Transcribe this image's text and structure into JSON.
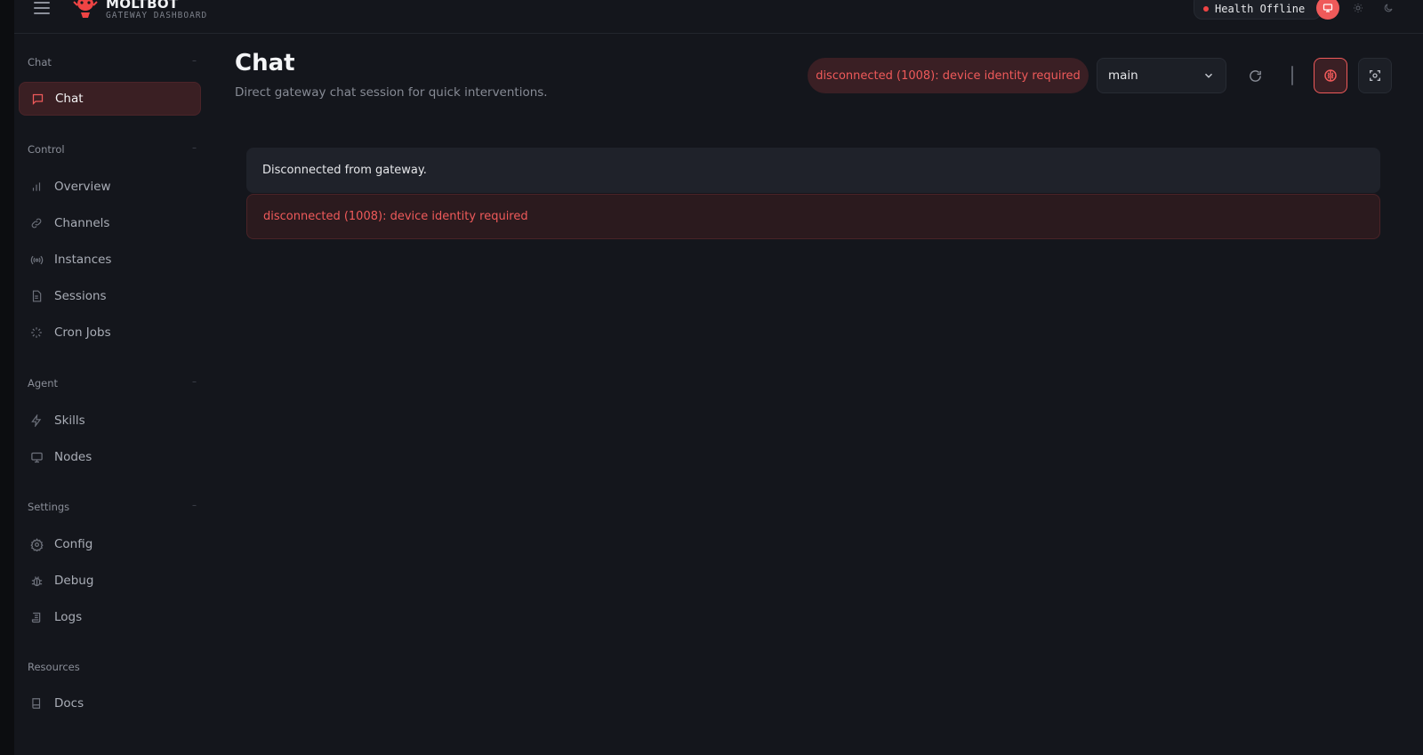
{
  "brand": {
    "name": "MOLTBOT",
    "subtitle": "GATEWAY DASHBOARD"
  },
  "health": {
    "label": "Health",
    "status": "Offline",
    "status_color": "#ef4444"
  },
  "theme": {
    "options": [
      "monitor-icon",
      "sun-icon",
      "moon-icon"
    ],
    "active": "monitor-icon"
  },
  "sidebar": {
    "sections": [
      {
        "title": "Chat",
        "items": [
          {
            "label": "Chat",
            "icon": "message-square-icon",
            "active": true
          }
        ]
      },
      {
        "title": "Control",
        "items": [
          {
            "label": "Overview",
            "icon": "bar-chart-icon"
          },
          {
            "label": "Channels",
            "icon": "link-icon"
          },
          {
            "label": "Instances",
            "icon": "radio-icon"
          },
          {
            "label": "Sessions",
            "icon": "file-text-icon"
          },
          {
            "label": "Cron Jobs",
            "icon": "loader-icon"
          }
        ]
      },
      {
        "title": "Agent",
        "items": [
          {
            "label": "Skills",
            "icon": "zap-icon"
          },
          {
            "label": "Nodes",
            "icon": "monitor-icon"
          }
        ]
      },
      {
        "title": "Settings",
        "items": [
          {
            "label": "Config",
            "icon": "settings-icon"
          },
          {
            "label": "Debug",
            "icon": "bug-icon"
          },
          {
            "label": "Logs",
            "icon": "scroll-icon"
          }
        ]
      },
      {
        "title": "Resources",
        "items": [
          {
            "label": "Docs",
            "icon": "book-icon"
          }
        ]
      }
    ]
  },
  "page": {
    "title": "Chat",
    "subtitle": "Direct gateway chat session for quick interventions."
  },
  "toolbar": {
    "error_pill": "disconnected (1008): device identity required",
    "session_value": "main",
    "accent_color": "#ef5a5a"
  },
  "messages": [
    {
      "type": "info",
      "text": "Disconnected from gateway."
    },
    {
      "type": "error",
      "text": "disconnected (1008): device identity required"
    }
  ]
}
